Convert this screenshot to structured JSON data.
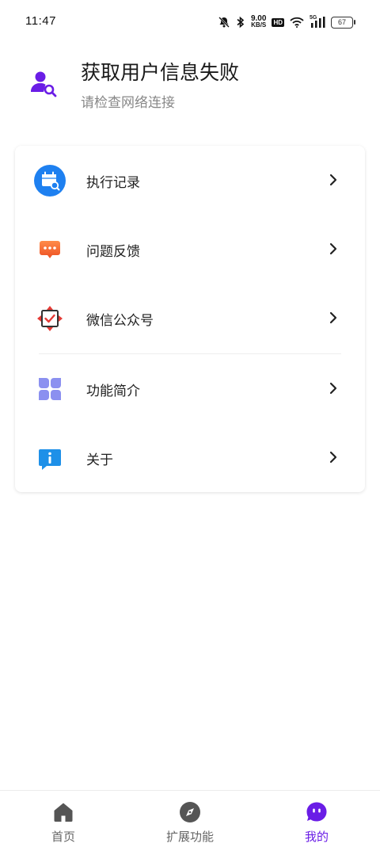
{
  "status_bar": {
    "time": "11:47",
    "net_speed_value": "9.00",
    "net_speed_unit": "KB/S",
    "hd_label": "HD",
    "network_label": "5G",
    "battery_level": "67"
  },
  "profile": {
    "title": "获取用户信息失败",
    "subtitle": "请检查网络连接",
    "accent_color": "#6a1de6"
  },
  "menu": {
    "items": [
      {
        "label": "执行记录",
        "icon": "calendar-search-icon"
      },
      {
        "label": "问题反馈",
        "icon": "chat-bubble-icon"
      },
      {
        "label": "微信公众号",
        "icon": "wechat-official-icon"
      },
      {
        "label": "功能简介",
        "icon": "grid-petal-icon"
      },
      {
        "label": "关于",
        "icon": "info-icon"
      }
    ]
  },
  "bottom_nav": {
    "items": [
      {
        "label": "首页",
        "icon": "home-icon",
        "active": false
      },
      {
        "label": "扩展功能",
        "icon": "compass-icon",
        "active": false
      },
      {
        "label": "我的",
        "icon": "profile-face-icon",
        "active": true
      }
    ],
    "active_color": "#6a1de6",
    "inactive_color": "#666666"
  }
}
